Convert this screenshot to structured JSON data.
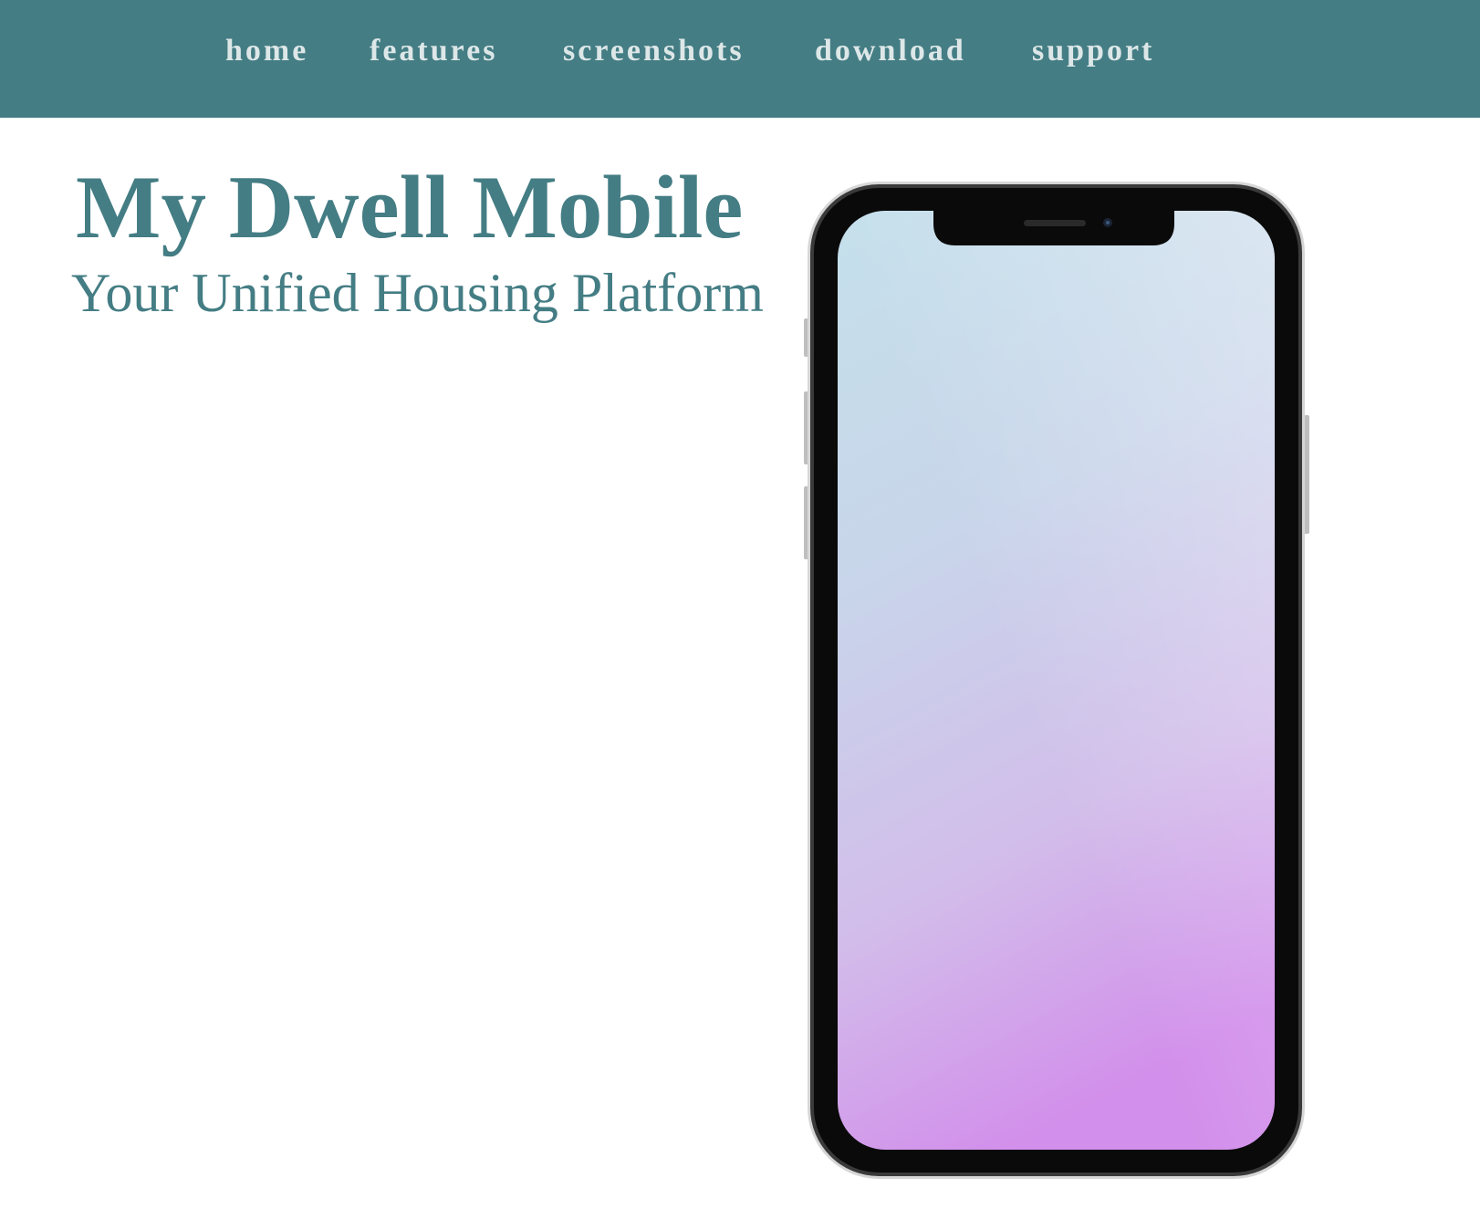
{
  "nav": {
    "background_color": "#447d84",
    "text_color": "#dde7e8",
    "items": [
      {
        "label": "home"
      },
      {
        "label": "features"
      },
      {
        "label": "screenshots"
      },
      {
        "label": "download"
      },
      {
        "label": "support"
      }
    ]
  },
  "hero": {
    "title": "My Dwell Mobile",
    "subtitle": "Your Unified Housing Platform",
    "text_color": "#447d84"
  },
  "phone_mockup": {
    "icon": "smartphone-icon",
    "screen_gradient": [
      "#c5dfeb",
      "#c8cfea",
      "#d3b4ea",
      "#d08eec"
    ]
  }
}
